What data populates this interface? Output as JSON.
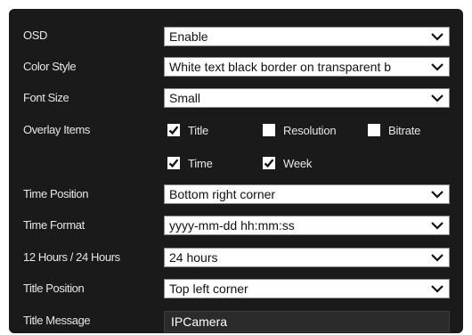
{
  "form": {
    "osd": {
      "label": "OSD",
      "value": "Enable"
    },
    "color_style": {
      "label": "Color Style",
      "value": "White text black border on transparent b"
    },
    "font_size": {
      "label": "Font Size",
      "value": "Small"
    },
    "overlay_items": {
      "label": "Overlay Items",
      "options": {
        "title": {
          "label": "Title",
          "checked": true
        },
        "resolution": {
          "label": "Resolution",
          "checked": false
        },
        "bitrate": {
          "label": "Bitrate",
          "checked": false
        },
        "time": {
          "label": "Time",
          "checked": true
        },
        "week": {
          "label": "Week",
          "checked": true
        }
      }
    },
    "time_position": {
      "label": "Time Position",
      "value": "Bottom right corner"
    },
    "time_format": {
      "label": "Time Format",
      "value": "yyyy-mm-dd hh:mm:ss"
    },
    "hour_mode": {
      "label": "12 Hours / 24 Hours",
      "value": "24 hours"
    },
    "title_position": {
      "label": "Title Position",
      "value": "Top left corner"
    },
    "title_message": {
      "label": "Title Message",
      "value": "IPCamera"
    }
  },
  "colors": {
    "panel_bg": "#1a1a1a",
    "label_text": "#e6e6e6",
    "select_bg": "#ffffff",
    "textbox_bg": "#2b2b2b"
  },
  "icons": {
    "dropdown": "chevron-down-icon",
    "checked": "checkmark-icon"
  }
}
